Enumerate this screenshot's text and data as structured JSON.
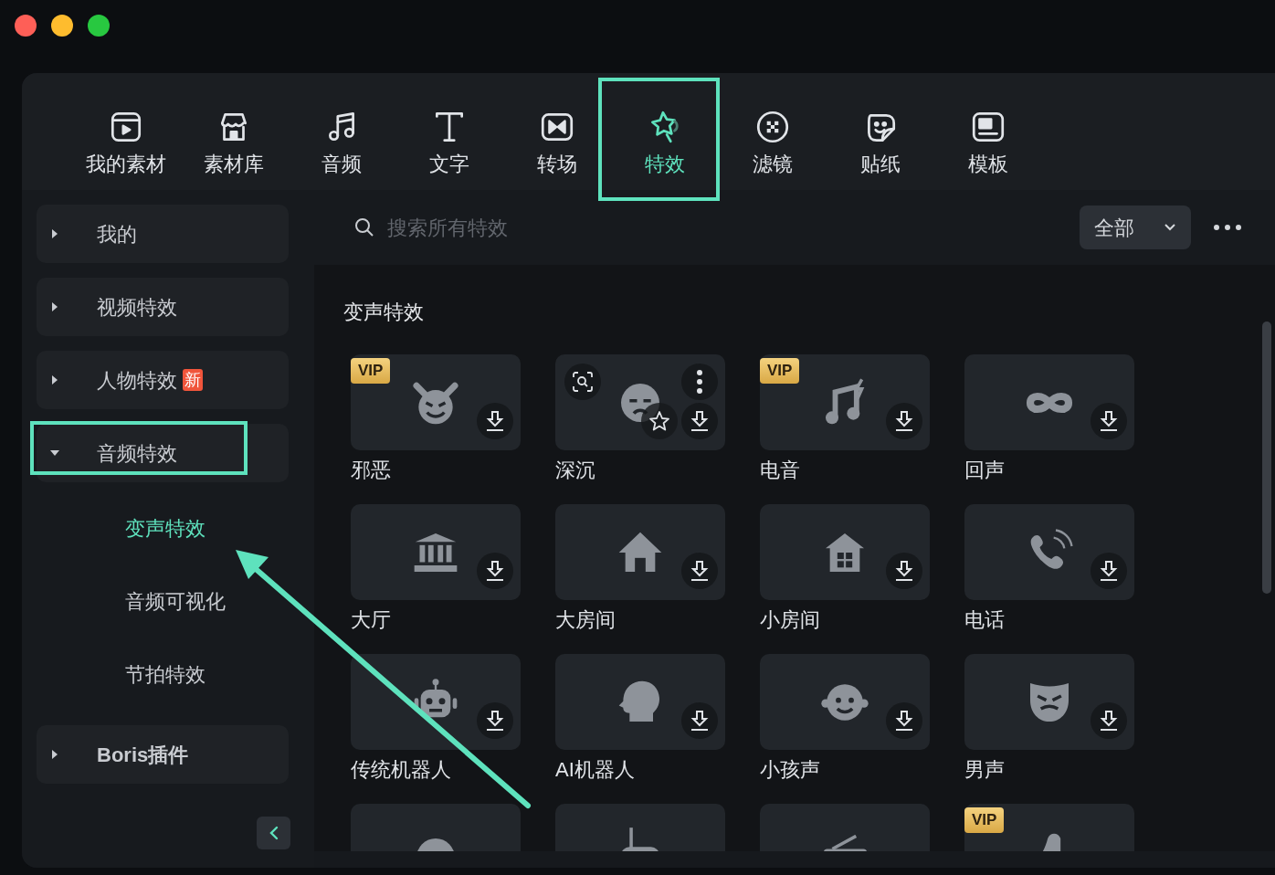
{
  "tabs": [
    {
      "label": "我的素材",
      "selected": false,
      "highlighted": false
    },
    {
      "label": "素材库",
      "selected": false,
      "highlighted": false
    },
    {
      "label": "音频",
      "selected": false,
      "highlighted": false
    },
    {
      "label": "文字",
      "selected": false,
      "highlighted": false
    },
    {
      "label": "转场",
      "selected": false,
      "highlighted": false
    },
    {
      "label": "特效",
      "selected": true,
      "highlighted": true
    },
    {
      "label": "滤镜",
      "selected": false,
      "highlighted": false
    },
    {
      "label": "贴纸",
      "selected": false,
      "highlighted": false
    },
    {
      "label": "模板",
      "selected": false,
      "highlighted": false
    }
  ],
  "sidebar": {
    "items": [
      {
        "label": "我的",
        "expanded": false,
        "highlighted": false
      },
      {
        "label": "视频特效",
        "expanded": false,
        "highlighted": false
      },
      {
        "label": "人物特效",
        "badge": "新",
        "expanded": false,
        "highlighted": false
      },
      {
        "label": "音频特效",
        "expanded": true,
        "highlighted": true,
        "children": [
          {
            "label": "变声特效",
            "selected": true
          },
          {
            "label": "音频可视化",
            "selected": false
          },
          {
            "label": "节拍特效",
            "selected": false
          }
        ]
      },
      {
        "label": "Boris插件",
        "expanded": false,
        "highlighted": false
      }
    ]
  },
  "search": {
    "placeholder": "搜索所有特效"
  },
  "filter": {
    "value": "全部"
  },
  "section": {
    "title": "变声特效"
  },
  "effects": [
    {
      "name": "邪恶",
      "badge": "VIP",
      "hovered": false
    },
    {
      "name": "深沉",
      "hovered": true
    },
    {
      "name": "电音",
      "badge": "VIP",
      "hovered": false
    },
    {
      "name": "回声",
      "hovered": false
    },
    {
      "name": "大厅",
      "hovered": false
    },
    {
      "name": "大房间",
      "hovered": false
    },
    {
      "name": "小房间",
      "hovered": false
    },
    {
      "name": "电话",
      "hovered": false
    },
    {
      "name": "传统机器人",
      "hovered": false
    },
    {
      "name": "AI机器人",
      "hovered": false
    },
    {
      "name": "小孩声",
      "hovered": false
    },
    {
      "name": "男声",
      "hovered": false
    },
    {
      "hovered": false
    },
    {
      "hovered": false
    },
    {
      "hovered": false
    },
    {
      "badge": "VIP",
      "hovered": false
    }
  ],
  "annotation_arrow": true
}
